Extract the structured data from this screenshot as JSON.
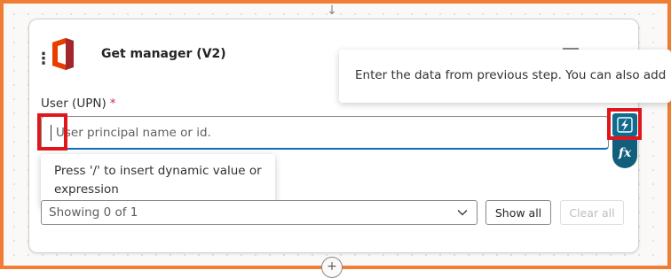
{
  "action": {
    "title": "Get manager (V2)",
    "icon": "office-365-icon",
    "menu_icon": "more-vertical-icon"
  },
  "tooltip_right": {
    "text": "Enter the data from previous step. You can also add"
  },
  "user_field": {
    "label": "User (UPN)",
    "required_marker": "*",
    "placeholder": "User principal name or id.",
    "value": ""
  },
  "dynamic_content_button": {
    "icon": "lightning-icon"
  },
  "expression_button": {
    "label": "fx"
  },
  "hint": {
    "text": "Press '/' to insert dynamic value or expression"
  },
  "advanced_params": {
    "select_value": "Showing 0 of 1",
    "show_all_label": "Show all",
    "clear_all_label": "Clear all"
  },
  "colors": {
    "frame_border": "#ef7d33",
    "highlight": "#e0161b",
    "accent": "#0f6cbd",
    "dynamic_button": "#0f6c8e"
  }
}
